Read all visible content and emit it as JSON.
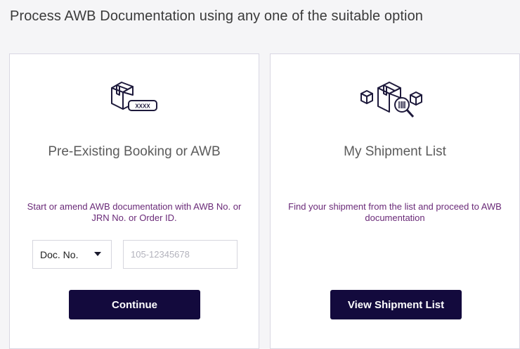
{
  "page": {
    "title": "Process AWB Documentation using any one of the suitable option"
  },
  "cards": {
    "existing": {
      "icon": "package-awb-icon",
      "title": "Pre-Existing Booking or AWB",
      "description": "Start or amend AWB documentation with AWB No. or JRN No. or Order ID.",
      "select_value": "Doc. No.",
      "input_placeholder": "105-12345678",
      "input_value": "",
      "button_label": "Continue",
      "icon_badge": "XXXX"
    },
    "shipments": {
      "icon": "packages-search-icon",
      "title": "My Shipment List",
      "description": "Find your shipment from the list and proceed to AWB documentation",
      "button_label": "View Shipment List"
    }
  },
  "colors": {
    "primary_button": "#130a3d",
    "description_text": "#6a2a78",
    "icon_stroke": "#1e1a3c",
    "background": "#f5f5f7"
  }
}
